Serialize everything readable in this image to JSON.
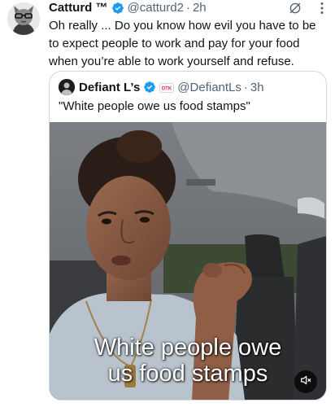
{
  "tweet": {
    "author_name": "Catturd ™",
    "handle": "@catturd2",
    "separator": "·",
    "time": "2h",
    "text": "Oh really ... Do you know how evil you have to be to expect people to work and pay for your food when you’re able to work yourself and refuse."
  },
  "quoted": {
    "author_name": "Defiant L’s",
    "handle": "@DefiantLs",
    "separator": "·",
    "time": "3h",
    "text": "\"White people owe us food stamps\"",
    "badge_text": "DTK"
  },
  "media": {
    "caption_line1": "White people owe",
    "caption_line2": "us food stamps"
  },
  "icons": {
    "verified": "verified-badge-icon",
    "grok": "grok-icon",
    "more": "more-options-icon",
    "mute": "volume-muted-icon"
  },
  "colors": {
    "text": "#0f1419",
    "secondary": "#536471",
    "verified": "#1d9bf0",
    "border": "#cfd9de"
  }
}
